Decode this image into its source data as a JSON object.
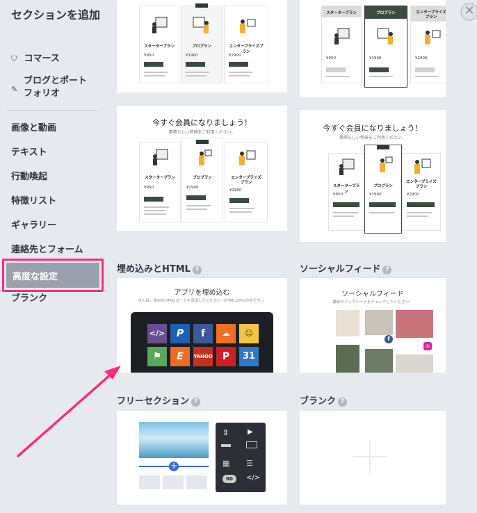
{
  "sidebar": {
    "title": "セクションを追加",
    "items": [
      {
        "label": "コマース",
        "icon": "shopping-bag-icon"
      },
      {
        "label": "ブログとポートフォリオ",
        "line1": "ブログとポート",
        "line2": "フォリオ",
        "icon": "edit-icon"
      },
      {
        "label": "画像と動画"
      },
      {
        "label": "テキスト"
      },
      {
        "label": "行動喚起"
      },
      {
        "label": "特徴リスト"
      },
      {
        "label": "ギャラリー"
      },
      {
        "label": "連絡先とフォーム"
      },
      {
        "label": "高度な設定"
      },
      {
        "label": "ブランク"
      }
    ]
  },
  "pricing": {
    "headline": "今すぐ会員になりましょう！",
    "subline": "素晴らしい特典をご利用ください。",
    "plans": [
      {
        "name": "スタータープラン",
        "price": "¥950"
      },
      {
        "name": "プロプラン",
        "price": "¥1900"
      },
      {
        "name": "エンタープライズプラン",
        "price": "¥2900"
      }
    ],
    "plans_alt": [
      {
        "name": "スタータープラン",
        "price": "¥950"
      },
      {
        "name": "プロプラン",
        "price": "¥1900"
      },
      {
        "name": "エンタープライズプラン",
        "name1": "エンタープライズ",
        "name2": "プラン",
        "price": "¥2900"
      }
    ]
  },
  "sections": {
    "embed_title": "埋め込みとHTML",
    "social_title": "ソーシャルフィード",
    "free_title": "フリーセクション",
    "blank_title": "ブランク"
  },
  "embed_card": {
    "heading": "アプリを埋め込む",
    "sub": "または、独自のHTMLコードを追加してください（HTMLはProのみです。）",
    "icons": [
      "code-icon",
      "paypal-icon",
      "facebook-icon",
      "soundcloud-icon",
      "mailchimp-icon",
      "maps-icon",
      "eventbrite-icon",
      "yelp-icon",
      "pinterest-icon",
      "calendar-icon"
    ]
  },
  "social_card": {
    "heading": "ソーシャルフィード",
    "sub": "最新のアップデートをチェックしてください！"
  },
  "free_card": {
    "badge": "60"
  },
  "colors": {
    "highlight": "#ff2d7a",
    "bg": "#e6e9ee"
  }
}
